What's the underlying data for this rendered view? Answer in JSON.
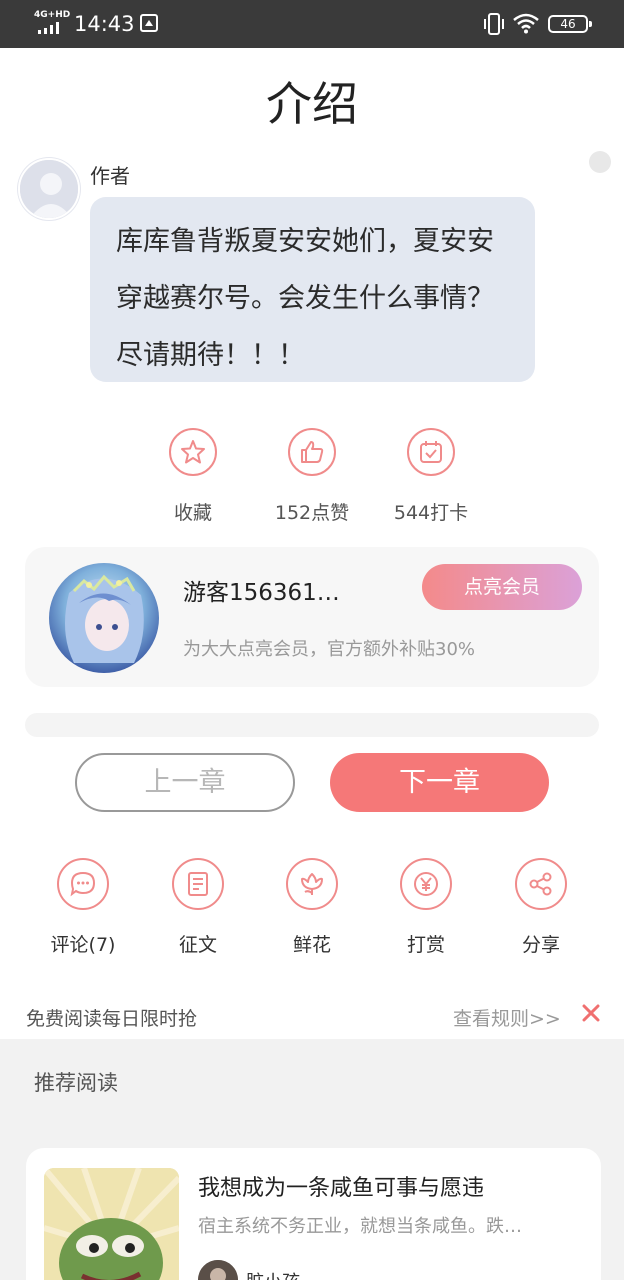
{
  "status_bar": {
    "network": "4G+HD",
    "time": "14:43",
    "battery": "46"
  },
  "page": {
    "title": "介绍"
  },
  "author_note": {
    "name": "作者",
    "message": "库库鲁背叛夏安安她们，夏安安穿越赛尔号。会发生什么事情？尽请期待！！！"
  },
  "actions": [
    {
      "label": "收藏",
      "icon": "star-icon"
    },
    {
      "label": "152点赞",
      "icon": "thumbs-up-icon"
    },
    {
      "label": "544打卡",
      "icon": "calendar-check-icon"
    }
  ],
  "member_card": {
    "username": "游客156361…",
    "description": "为大大点亮会员，官方额外补贴30%",
    "button_label": "点亮会员"
  },
  "chapter_nav": {
    "prev_label": "上一章",
    "next_label": "下一章"
  },
  "tools": [
    {
      "label": "评论(7)",
      "icon": "comment-icon"
    },
    {
      "label": "征文",
      "icon": "document-icon"
    },
    {
      "label": "鲜花",
      "icon": "flower-icon"
    },
    {
      "label": "打赏",
      "icon": "yen-coin-icon"
    },
    {
      "label": "分享",
      "icon": "share-icon"
    }
  ],
  "promo": {
    "text": "免费阅读每日限时抢",
    "rules_label": "查看规则>>"
  },
  "recommend": {
    "title": "推荐阅读",
    "book": {
      "title": "我想成为一条咸鱼可事与愿违",
      "description": "宿主系统不务正业，就想当条咸鱼。跌…",
      "author": "脏小孩"
    }
  },
  "colors": {
    "accent": "#f57878",
    "accent_outline": "#f08b8b",
    "bubble_bg": "#e3e8f1",
    "status_bar_bg": "#3a3a3a"
  }
}
